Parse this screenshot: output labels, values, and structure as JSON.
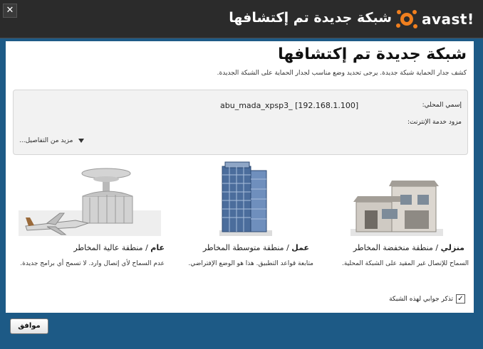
{
  "window": {
    "title": "شبكة جديدة تم إكتشافها",
    "logo_text": "avast!",
    "close_glyph": "✕"
  },
  "main": {
    "heading": "شبكة جديدة تم إكتشافها",
    "subtitle": "كشف جدار الحماية شبكة جديدة. يرجى تحديد وضع مناسب لجدار الحماية على الشبكة الجديدة."
  },
  "network_info": {
    "local_name_label": "إسمي المحلي:",
    "local_name_value": "abu_mada_xpsp3_ [192.168.1.100]",
    "isp_label": "مزود خدمة الإنترنت:",
    "more_details": "مزيد من التفاصيل..."
  },
  "zones": {
    "home": {
      "title_bold": "منزلي",
      "title_rest": " / منطقة منخفضة المخاطر",
      "desc": "السماح للإتصال غير المقيد على الشبكة المحلية."
    },
    "work": {
      "title_bold": "عمل",
      "title_rest": " / منطقة متوسطة المخاطر",
      "desc": "متابعة قواعد التطبيق. هذا هو الوضع الإفتراضي."
    },
    "public": {
      "title_bold": "عام",
      "title_rest": " / منطقة عالية المخاطر",
      "desc": "عدم السماح لأي إتصال وارد. لا تسمح أي برامج جديدة."
    }
  },
  "remember": {
    "label": "تذكر جوابي لهذه الشبكة",
    "checked": true
  },
  "buttons": {
    "ok": "موافق"
  },
  "colors": {
    "frame": "#1d5a86",
    "titlebar": "#2b2b2b",
    "logo_orange": "#f07f1e"
  }
}
